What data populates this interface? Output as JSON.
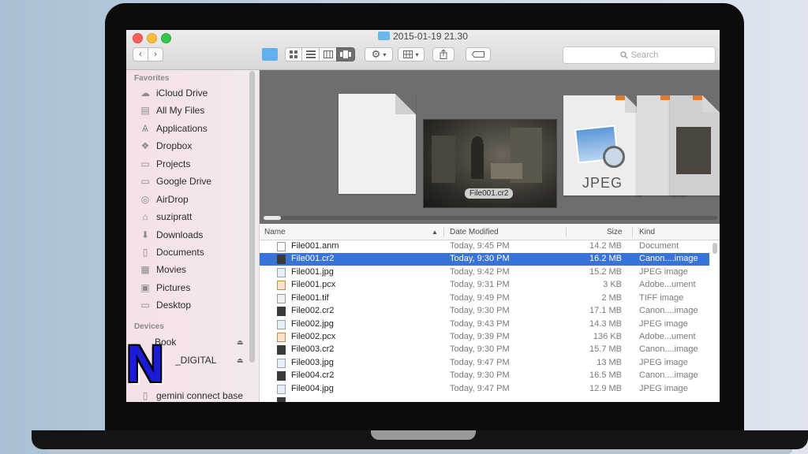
{
  "window": {
    "title": "2015-01-19 21.30"
  },
  "toolbar": {
    "back_label": "‹",
    "forward_label": "›",
    "search_placeholder": "Search",
    "view_buttons": [
      "icon-view",
      "list-view",
      "column-view",
      "coverflow-view"
    ],
    "selected_view": "coverflow-view"
  },
  "sidebar": {
    "favorites_header": "Favorites",
    "favorites": [
      {
        "label": "iCloud Drive",
        "icon": "cloud-icon"
      },
      {
        "label": "All My Files",
        "icon": "files-icon"
      },
      {
        "label": "Applications",
        "icon": "applications-icon"
      },
      {
        "label": "Dropbox",
        "icon": "dropbox-icon"
      },
      {
        "label": "Projects",
        "icon": "folder-icon"
      },
      {
        "label": "Google Drive",
        "icon": "folder-icon"
      },
      {
        "label": "AirDrop",
        "icon": "airdrop-icon"
      },
      {
        "label": "suzipratt",
        "icon": "home-icon"
      },
      {
        "label": "Downloads",
        "icon": "downloads-icon"
      },
      {
        "label": "Documents",
        "icon": "documents-icon"
      },
      {
        "label": "Movies",
        "icon": "movies-icon"
      },
      {
        "label": "Pictures",
        "icon": "pictures-icon"
      },
      {
        "label": "Desktop",
        "icon": "desktop-icon"
      }
    ],
    "devices_header": "Devices",
    "devices": [
      {
        "label": "Book",
        "icon": "disk-icon"
      },
      {
        "label": "_DIGITAL",
        "icon": "disk-icon"
      },
      {
        "label": "gemini connect base",
        "icon": "disk-icon"
      }
    ]
  },
  "preview": {
    "caption": "File001.cr2",
    "jpeg_label": "JPEG"
  },
  "columns": {
    "name": "Name",
    "date": "Date Modified",
    "size": "Size",
    "kind": "Kind"
  },
  "files": [
    {
      "name": "File001.anm",
      "date": "Today, 9:45 PM",
      "size": "14.2 MB",
      "kind": "Document",
      "type": "doc"
    },
    {
      "name": "File001.cr2",
      "date": "Today, 9:30 PM",
      "size": "16.2 MB",
      "kind": "Canon....image",
      "type": "cr2",
      "selected": true
    },
    {
      "name": "File001.jpg",
      "date": "Today, 9:42 PM",
      "size": "15.2 MB",
      "kind": "JPEG image",
      "type": "jpg"
    },
    {
      "name": "File001.pcx",
      "date": "Today, 9:31 PM",
      "size": "3 KB",
      "kind": "Adobe...ument",
      "type": "pcx"
    },
    {
      "name": "File001.tif",
      "date": "Today, 9:49 PM",
      "size": "2 MB",
      "kind": "TIFF image",
      "type": "tif"
    },
    {
      "name": "File002.cr2",
      "date": "Today, 9:30 PM",
      "size": "17.1 MB",
      "kind": "Canon....image",
      "type": "cr2"
    },
    {
      "name": "File002.jpg",
      "date": "Today, 9:43 PM",
      "size": "14.3 MB",
      "kind": "JPEG image",
      "type": "jpg"
    },
    {
      "name": "File002.pcx",
      "date": "Today, 9:39 PM",
      "size": "136 KB",
      "kind": "Adobe...ument",
      "type": "pcx"
    },
    {
      "name": "File003.cr2",
      "date": "Today, 9:30 PM",
      "size": "15.7 MB",
      "kind": "Canon....image",
      "type": "cr2"
    },
    {
      "name": "File003.jpg",
      "date": "Today, 9:47 PM",
      "size": "13 MB",
      "kind": "JPEG image",
      "type": "jpg"
    },
    {
      "name": "File004.cr2",
      "date": "Today, 9:30 PM",
      "size": "16.5 MB",
      "kind": "Canon....image",
      "type": "cr2"
    },
    {
      "name": "File004.jpg",
      "date": "Today, 9:47 PM",
      "size": "12.9 MB",
      "kind": "JPEG image",
      "type": "jpg"
    }
  ],
  "overlay": {
    "badge_letter": "N"
  },
  "colors": {
    "selection": "#3874d8",
    "sidebar_bg": "#f4e1e6",
    "preview_bg": "#6e6e6e"
  }
}
